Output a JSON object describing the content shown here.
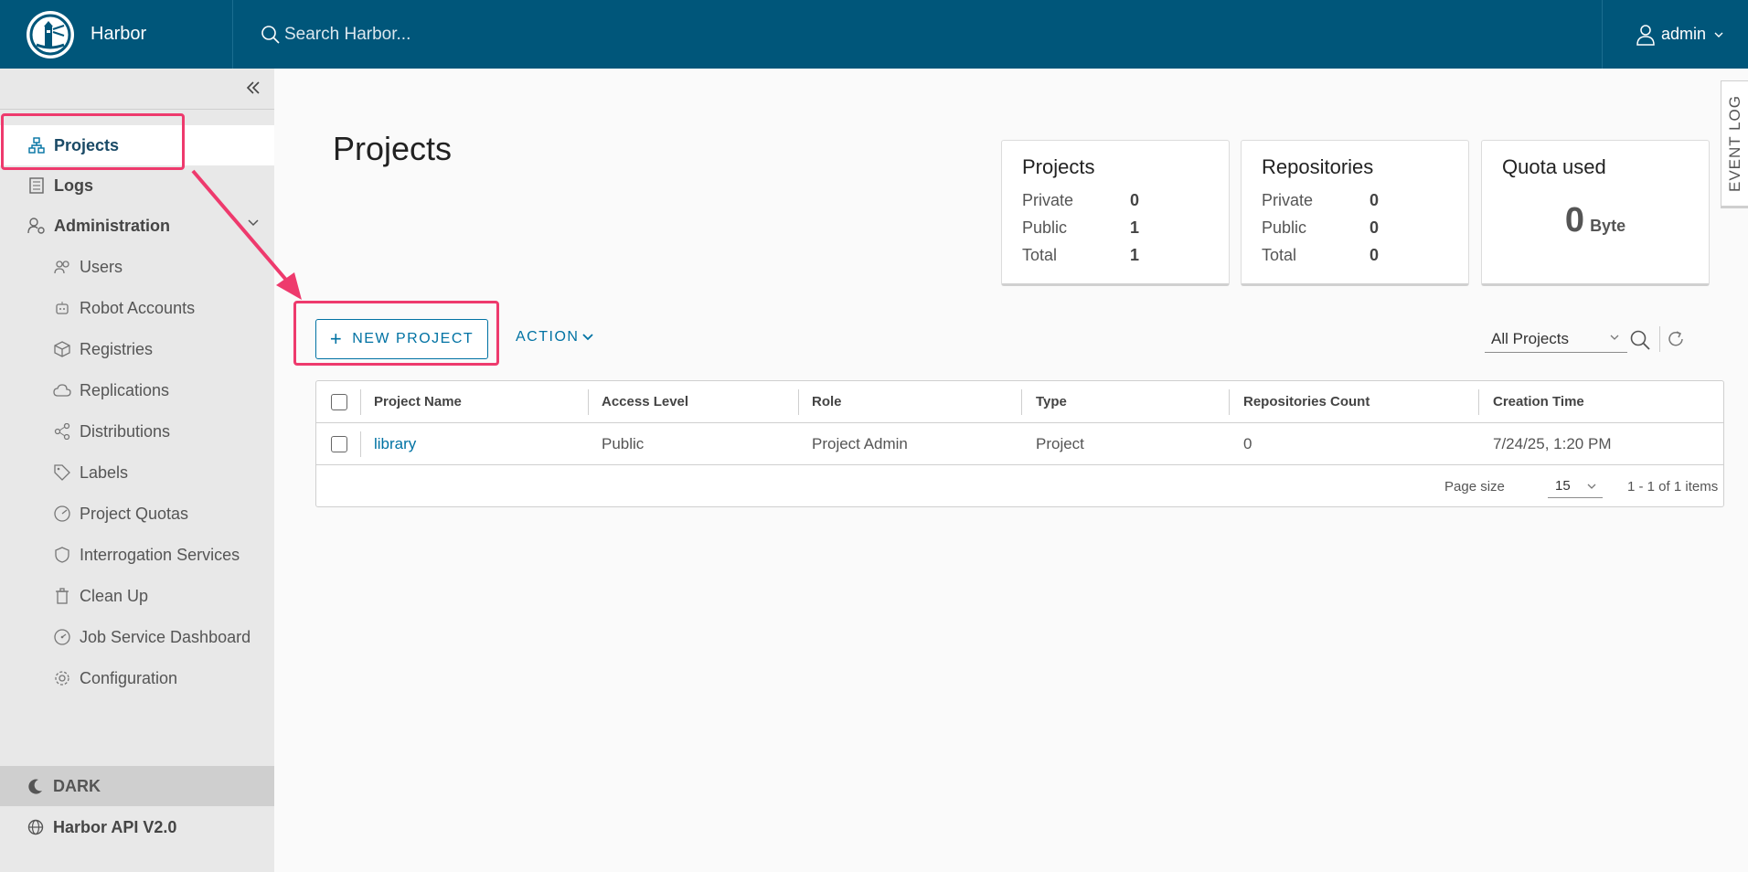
{
  "header": {
    "brand": "Harbor",
    "search_placeholder": "Search Harbor...",
    "user": "admin"
  },
  "sidebar": {
    "items": [
      {
        "label": "Projects",
        "icon": "projects-icon"
      },
      {
        "label": "Logs",
        "icon": "logs-icon"
      },
      {
        "label": "Administration",
        "icon": "administration-icon"
      }
    ],
    "admin_items": [
      {
        "label": "Users",
        "icon": "users-icon"
      },
      {
        "label": "Robot Accounts",
        "icon": "robot-icon"
      },
      {
        "label": "Registries",
        "icon": "registries-icon"
      },
      {
        "label": "Replications",
        "icon": "replications-icon"
      },
      {
        "label": "Distributions",
        "icon": "distributions-icon"
      },
      {
        "label": "Labels",
        "icon": "labels-icon"
      },
      {
        "label": "Project Quotas",
        "icon": "quotas-icon"
      },
      {
        "label": "Interrogation Services",
        "icon": "shield-icon"
      },
      {
        "label": "Clean Up",
        "icon": "trash-icon"
      },
      {
        "label": "Job Service Dashboard",
        "icon": "dashboard-icon"
      },
      {
        "label": "Configuration",
        "icon": "gear-icon"
      }
    ],
    "dark": "DARK",
    "api": "Harbor API V2.0"
  },
  "main": {
    "title": "Projects",
    "cards": {
      "projects": {
        "title": "Projects",
        "private_label": "Private",
        "private": "0",
        "public_label": "Public",
        "public": "1",
        "total_label": "Total",
        "total": "1"
      },
      "repositories": {
        "title": "Repositories",
        "private_label": "Private",
        "private": "0",
        "public_label": "Public",
        "public": "0",
        "total_label": "Total",
        "total": "0"
      },
      "quota": {
        "title": "Quota used",
        "value": "0",
        "unit": "Byte"
      }
    },
    "event_log": "EVENT LOG",
    "new_project": "NEW PROJECT",
    "action": "ACTION",
    "filter": "All Projects",
    "table": {
      "headers": [
        "Project Name",
        "Access Level",
        "Role",
        "Type",
        "Repositories Count",
        "Creation Time"
      ],
      "rows": [
        [
          "library",
          "Public",
          "Project Admin",
          "Project",
          "0",
          "7/24/25, 1:20 PM"
        ]
      ],
      "page_size_label": "Page size",
      "page_size": "15",
      "pagination": "1 - 1 of 1 items"
    }
  },
  "colors": {
    "header_bg": "#00567a",
    "accent": "#0072a3",
    "highlight": "#ee3a6d"
  }
}
